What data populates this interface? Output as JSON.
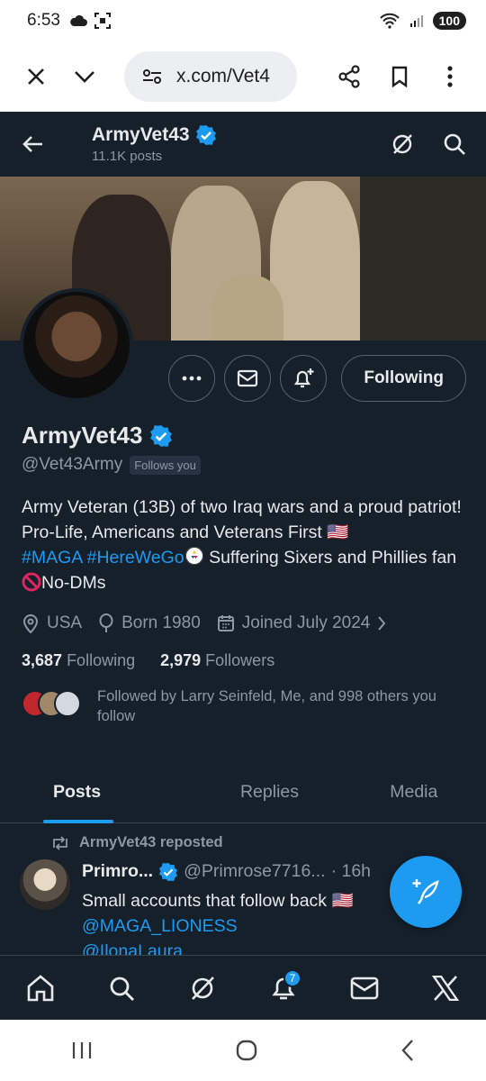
{
  "status_bar": {
    "time": "6:53",
    "battery": "100"
  },
  "browser": {
    "url": "x.com/Vet4"
  },
  "header": {
    "name": "ArmyVet43",
    "posts_count": "11.1K posts"
  },
  "profile": {
    "display_name": "ArmyVet43",
    "handle": "@Vet43Army",
    "follows_you": "Follows you",
    "following_button": "Following",
    "bio_line1": "Army Veteran (13B) of two Iraq wars and a proud patriot! Pro-Life, Americans and Veterans First 🇺🇸",
    "bio_tag1": "#MAGA",
    "bio_tag2": "#HereWeGo",
    "bio_line2": " Suffering Sixers and Phillies fan ",
    "bio_line3": "No-DMs",
    "location": "USA",
    "born": "Born 1980",
    "joined": "Joined July 2024",
    "following_count": "3,687",
    "following_label": "Following",
    "followers_count": "2,979",
    "followers_label": "Followers",
    "followed_by": "Followed by Larry Seinfeld, Me, and 998 others you follow"
  },
  "tabs": [
    {
      "label": "Posts"
    },
    {
      "label": "Replies"
    },
    {
      "label": "Media"
    }
  ],
  "post": {
    "reposted_by": "ArmyVet43 reposted",
    "author_name": "Primro...",
    "author_handle": "@Primrose7716...",
    "time": "· 16h",
    "text": "Small accounts that follow back 🇺🇸",
    "mention1": "@MAGA_LIONESS",
    "mention2": "@IlonaLaura"
  },
  "bottom_nav": {
    "notification_badge": "7"
  },
  "colors": {
    "background": "#15202b",
    "accent": "#1d9bf0",
    "muted": "#8b98a5"
  }
}
